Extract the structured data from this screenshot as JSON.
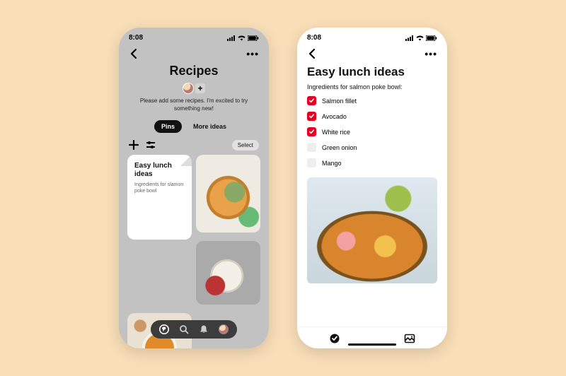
{
  "status": {
    "time": "8:08"
  },
  "left": {
    "title": "Recipes",
    "description": "Please add some recipes. I'm excited to try something new!",
    "tabs": {
      "pins": "Pins",
      "more": "More ideas"
    },
    "select": "Select",
    "note": {
      "title": "Easy lunch ideas",
      "subtitle": "Ingredients for slamon poke bowl"
    }
  },
  "right": {
    "title": "Easy lunch ideas",
    "subtitle": "Ingredients for salmon poke bowl:",
    "items": [
      {
        "label": "Salmon fillet",
        "checked": true
      },
      {
        "label": "Avocado",
        "checked": true
      },
      {
        "label": "White rice",
        "checked": true
      },
      {
        "label": "Green onion",
        "checked": false
      },
      {
        "label": "Mango",
        "checked": false
      }
    ]
  }
}
